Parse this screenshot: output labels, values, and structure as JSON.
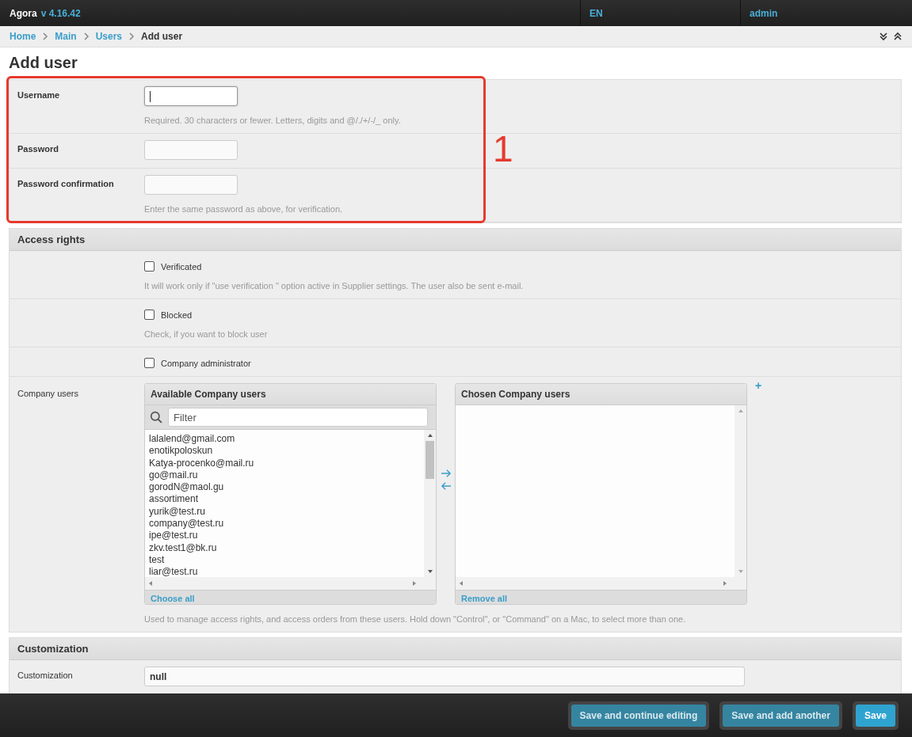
{
  "header": {
    "brand": "Agora",
    "version": "v 4.16.42",
    "language": "EN",
    "user": "admin"
  },
  "breadcrumbs": [
    {
      "label": "Home",
      "kind": "link"
    },
    {
      "label": "Main",
      "kind": "link"
    },
    {
      "label": "Users",
      "kind": "link"
    },
    {
      "label": "Add user",
      "kind": "current"
    }
  ],
  "page_title": "Add user",
  "annotation": {
    "label": "1"
  },
  "account_fields": [
    {
      "label": "Username",
      "focused": true,
      "help": "Required. 30 characters or fewer. Letters, digits and @/./+/-/_ only."
    },
    {
      "label": "Password",
      "focused": false
    },
    {
      "label": "Password confirmation",
      "focused": false,
      "help": "Enter the same password as above, for verification."
    }
  ],
  "access_rights": {
    "title": "Access rights",
    "checkboxes": [
      {
        "label": "Verificated",
        "checked": false,
        "help": "It will work only if \"use verification \" option active in Supplier settings. The user also be sent e-mail."
      },
      {
        "label": "Blocked",
        "checked": false,
        "help": "Check, if you want to block user"
      },
      {
        "label": "Company administrator",
        "checked": false
      }
    ],
    "company_users": {
      "label": "Company users",
      "available": {
        "title": "Available Company users",
        "filter_placeholder": "Filter",
        "action": "Choose all",
        "items": [
          "lalalend@gmail.com",
          "enotikpoloskun",
          "Katya-procenko@mail.ru",
          "go@mail.ru",
          "gorodN@maol.gu",
          "assortiment",
          "yurik@test.ru",
          "company@test.ru",
          "ipe@test.ru",
          "zkv.test1@bk.ru",
          "test",
          "liar@test.ru"
        ]
      },
      "chosen": {
        "title": "Chosen Company users",
        "action": "Remove all"
      },
      "add_label": "+",
      "help": "Used to manage access rights, and access orders from these users. Hold down \"Control\", or \"Command\" on a Mac, to select more than one."
    }
  },
  "customization": {
    "title": "Customization",
    "label": "Customization",
    "value": "null"
  },
  "footer_buttons": [
    {
      "label": "Save and continue editing",
      "kind": "secondary"
    },
    {
      "label": "Save and add another",
      "kind": "secondary"
    },
    {
      "label": "Save",
      "kind": "primary"
    }
  ]
}
